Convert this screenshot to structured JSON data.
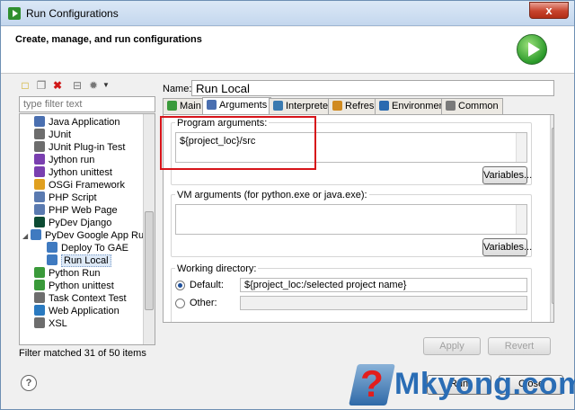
{
  "window": {
    "title": "Run Configurations",
    "close": "x"
  },
  "header": {
    "title": "Create, manage, and run configurations"
  },
  "left": {
    "filter_placeholder": "type filter text",
    "tree": [
      {
        "label": "Java Application",
        "icon": "java-app-icon",
        "color": "#4a6fb0"
      },
      {
        "label": "JUnit",
        "icon": "junit-icon",
        "color": "#6d6d6d"
      },
      {
        "label": "JUnit Plug-in Test",
        "icon": "junit-plugin-icon",
        "color": "#6d6d6d"
      },
      {
        "label": "Jython run",
        "icon": "jython-run-icon",
        "color": "#7a3fb0"
      },
      {
        "label": "Jython unittest",
        "icon": "jython-unittest-icon",
        "color": "#7a3fb0"
      },
      {
        "label": "OSGi Framework",
        "icon": "osgi-icon",
        "color": "#e0a020"
      },
      {
        "label": "PHP Script",
        "icon": "php-script-icon",
        "color": "#5a7ab0"
      },
      {
        "label": "PHP Web Page",
        "icon": "php-web-icon",
        "color": "#5a7ab0"
      },
      {
        "label": "PyDev Django",
        "icon": "django-icon",
        "color": "#0c4b33"
      },
      {
        "label": "PyDev Google App Run",
        "icon": "gae-icon",
        "color": "#3f7ac0"
      },
      {
        "label": "Deploy To GAE",
        "icon": "deploy-gae-icon",
        "color": "#3f7ac0"
      },
      {
        "label": "Run Local",
        "icon": "run-local-icon",
        "color": "#3f7ac0"
      },
      {
        "label": "Python Run",
        "icon": "python-run-icon",
        "color": "#3a9a3a"
      },
      {
        "label": "Python unittest",
        "icon": "python-unittest-icon",
        "color": "#3a9a3a"
      },
      {
        "label": "Task Context Test",
        "icon": "task-context-icon",
        "color": "#6d6d6d"
      },
      {
        "label": "Web Application",
        "icon": "web-app-icon",
        "color": "#2a7ac0"
      },
      {
        "label": "XSL",
        "icon": "xsl-icon",
        "color": "#6d6d6d"
      }
    ],
    "status": "Filter matched 31 of 50 items"
  },
  "right": {
    "name_label": "Name:",
    "name_value": "Run Local",
    "tabs": [
      {
        "label": "Main",
        "icon": "main-tab-icon"
      },
      {
        "label": "Arguments",
        "icon": "arguments-tab-icon"
      },
      {
        "label": "Interpreter",
        "icon": "interpreter-tab-icon"
      },
      {
        "label": "Refresh",
        "icon": "refresh-tab-icon"
      },
      {
        "label": "Environment",
        "icon": "environment-tab-icon"
      },
      {
        "label": "Common",
        "icon": "common-tab-icon"
      }
    ],
    "program_args": {
      "label": "Program arguments:",
      "value": "${project_loc}/src",
      "variables": "Variables..."
    },
    "vm_args": {
      "label": "VM arguments (for python.exe or java.exe):",
      "value": "",
      "variables": "Variables..."
    },
    "working_dir": {
      "label": "Working directory:",
      "default_label": "Default:",
      "default_value": "${project_loc:/selected project name}",
      "other_label": "Other:",
      "other_value": ""
    },
    "apply": "Apply",
    "revert": "Revert"
  },
  "footer": {
    "help": "?",
    "run": "Run",
    "close": "Close"
  },
  "watermark": {
    "text": "Mkyong.com",
    "glyph": "?"
  },
  "colors": {
    "highlight": "#d7141a",
    "accent": "#1e4f9a"
  }
}
